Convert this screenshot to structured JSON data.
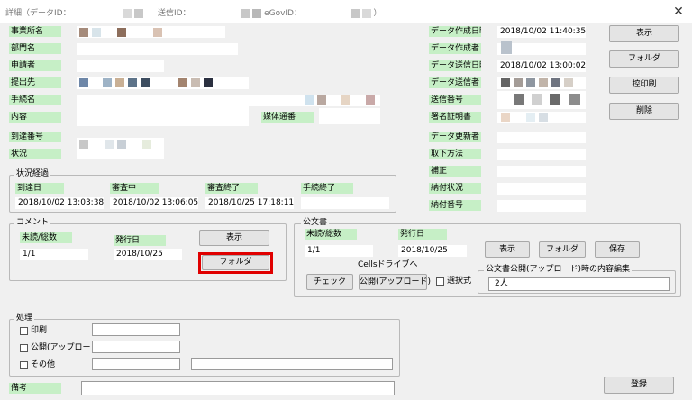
{
  "window": {
    "title_prefix": "詳細（データID：",
    "title_middle": "送信ID：",
    "title_egov": "eGovID：",
    "title_suffix": "）",
    "close_glyph": "✕"
  },
  "left_fields": [
    {
      "label": "事業所名",
      "value": ""
    },
    {
      "label": "部門名",
      "value": ""
    },
    {
      "label": "申請者",
      "value": ""
    },
    {
      "label": "提出先",
      "value": ""
    },
    {
      "label": "手続名",
      "value": ""
    },
    {
      "label": "内容",
      "value": ""
    },
    {
      "label": "到達番号",
      "value": ""
    },
    {
      "label": "状況",
      "value": ""
    }
  ],
  "baitai": {
    "label": "媒体通番",
    "value": ""
  },
  "right_fields": [
    {
      "label": "データ作成日時",
      "value": "2018/10/02 11:40:35"
    },
    {
      "label": "データ作成者",
      "value": ""
    },
    {
      "label": "データ送信日時",
      "value": "2018/10/02 13:00:02"
    },
    {
      "label": "データ送信者",
      "value": ""
    },
    {
      "label": "送信番号",
      "value": ""
    },
    {
      "label": "署名証明書",
      "value": ""
    },
    {
      "label": "データ更新者",
      "value": ""
    },
    {
      "label": "取下方法",
      "value": ""
    },
    {
      "label": "補正",
      "value": ""
    },
    {
      "label": "納付状況",
      "value": ""
    },
    {
      "label": "納付番号",
      "value": ""
    }
  ],
  "side_buttons": {
    "display": "表示",
    "folder": "フォルダ",
    "print": "控印刷",
    "delete": "削除"
  },
  "status": {
    "title": "状況経過",
    "columns": [
      {
        "label": "到達日",
        "value": "2018/10/02 13:03:38"
      },
      {
        "label": "審査中",
        "value": "2018/10/02 13:06:05"
      },
      {
        "label": "審査終了",
        "value": "2018/10/25 17:18:11"
      },
      {
        "label": "手続終了",
        "value": ""
      }
    ]
  },
  "comment": {
    "title": "コメント",
    "unread_label": "未読/総数",
    "unread_value": "1/1",
    "date_label": "発行日",
    "date_value": "2018/10/25",
    "display_button": "表示",
    "folder_button": "フォルダ"
  },
  "official": {
    "title": "公文書",
    "unread_label": "未読/総数",
    "unread_value": "1/1",
    "date_label": "発行日",
    "date_value": "2018/10/25",
    "display_button": "表示",
    "folder_button": "フォルダ",
    "save_button": "保存",
    "cells_label": "Cellsドライブへ",
    "check_button": "チェック",
    "upload_button": "公開(アップロード)",
    "select_label": "選択式",
    "edit_group_title": "公文書公開(アップロード)時の内容編集",
    "edit_value": "2人"
  },
  "process": {
    "title": "処理",
    "print_label": "印刷",
    "publish_label": "公開(アップロード)",
    "other_label": "その他"
  },
  "remarks": {
    "label": "備考",
    "value": ""
  },
  "register_button": "登録",
  "colors": {
    "label_green": "#c6efc6",
    "highlight_red": "#e00000",
    "background": "#f0f0f0"
  }
}
